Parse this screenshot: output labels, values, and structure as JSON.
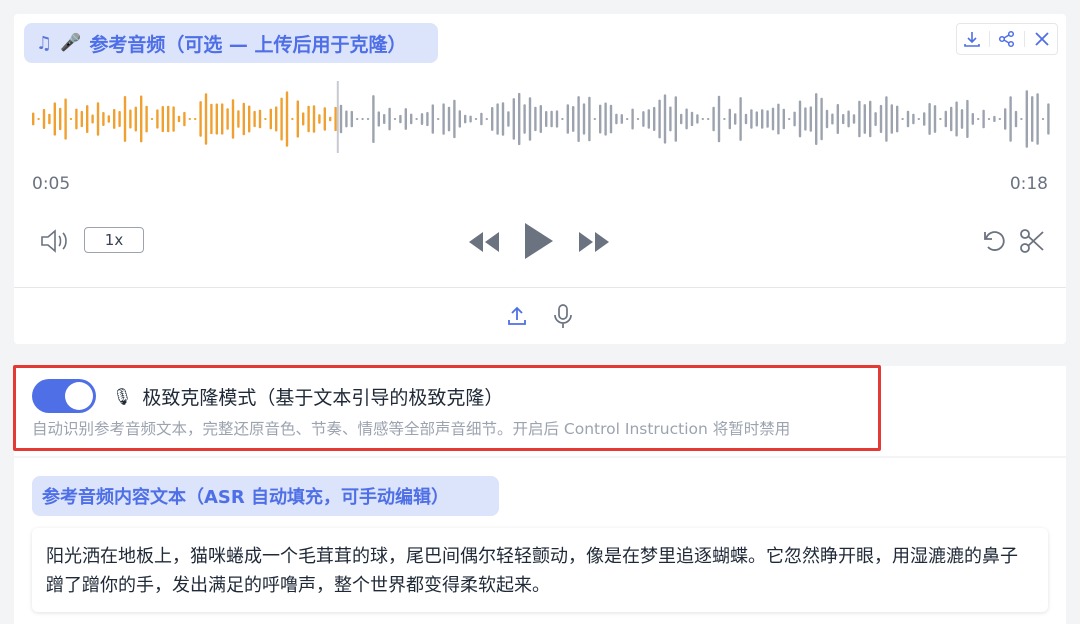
{
  "audio": {
    "label": "参考音频（可选 — 上传后用于克隆）",
    "time_start": "0:05",
    "time_end": "0:18",
    "progress": 0.3,
    "rate": "1x",
    "played_color": "#f0a030",
    "unplayed_color": "#9ca3af"
  },
  "clone_mode": {
    "enabled": true,
    "title": "极致克隆模式（基于文本引导的极致克隆）",
    "description": "自动识别参考音频文本，完整还原音色、节奏、情感等全部声音细节。开启后 Control Instruction 将暂时禁用"
  },
  "ref_text": {
    "label": "参考音频内容文本（ASR 自动填充，可手动编辑）",
    "content": "阳光洒在地板上，猫咪蜷成一个毛茸茸的球，尾巴间偶尔轻轻颤动，像是在梦里追逐蝴蝶。它忽然睁开眼，用湿漉漉的鼻子蹭了蹭你的手，发出满足的呼噜声，整个世界都变得柔软起来。"
  },
  "colors": {
    "accent": "#4f6fe6",
    "highlight": "#e53935"
  }
}
